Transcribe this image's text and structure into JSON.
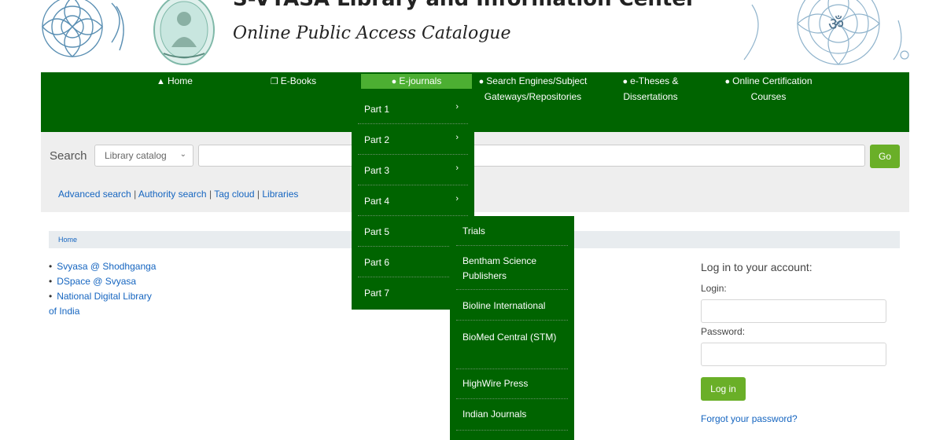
{
  "banner": {
    "title_top": "S-VYASA Library and Information Center",
    "title_sub": "Online Public Access Catalogue"
  },
  "nav": {
    "items": [
      {
        "label": "Home",
        "icon": "home-icon"
      },
      {
        "label": "E-Books",
        "icon": "copy-icon"
      },
      {
        "label": "E-journals",
        "icon": "users-icon"
      },
      {
        "label": "Search Engines/Subject Gateways/Repositories",
        "icon": "users-icon"
      },
      {
        "label": "e-Theses & Dissertations",
        "icon": "users-icon"
      },
      {
        "label": "Online Certification Courses",
        "icon": "users-icon"
      }
    ],
    "active_color": "#4caf32",
    "bar_color": "#006400"
  },
  "dropdown": {
    "items": [
      {
        "label": "Part 1",
        "has_submenu": true
      },
      {
        "label": "Part 2",
        "has_submenu": true
      },
      {
        "label": "Part 3",
        "has_submenu": true
      },
      {
        "label": "Part 4",
        "has_submenu": true
      },
      {
        "label": "Part 5",
        "has_submenu": false
      },
      {
        "label": "Part 6",
        "has_submenu": false
      },
      {
        "label": "Part 7",
        "has_submenu": false
      }
    ],
    "arrow": "›"
  },
  "submenu": {
    "items": [
      "Trials",
      "Bentham Science Publishers",
      "Bioline International",
      "BioMed Central (STM)",
      "HighWire Press",
      "Indian Journals"
    ]
  },
  "search": {
    "label": "Search",
    "select_value": "Library catalog",
    "go_label": "Go"
  },
  "links": {
    "advanced": "Advanced search",
    "authority": "Authority search",
    "tagcloud": "Tag cloud",
    "libraries": "Libraries",
    "separator": "|"
  },
  "breadcrumb": {
    "home": "Home"
  },
  "left_links": {
    "items": [
      "Svyasa @ Shodhganga",
      "DSpace @ Svyasa",
      "National Digital Library",
      "of India"
    ]
  },
  "login": {
    "heading": "Log in to your account:",
    "login_label": "Login:",
    "password_label": "Password:",
    "button": "Log in",
    "forgot": "Forgot your password?"
  }
}
